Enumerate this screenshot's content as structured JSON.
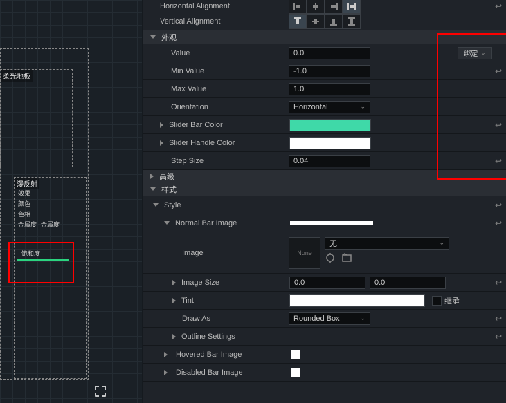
{
  "viewport": {
    "panel1_label": "柔光地板",
    "panel2_label": "漫反射",
    "sub1": "效果",
    "sub2": "颜色",
    "sub3": "色相",
    "sub4a": "金属度",
    "sub4b": "金属度",
    "sub5": "饱和度"
  },
  "props": {
    "horiz_align": "Horizontal Alignment",
    "vert_align": "Vertical Alignment",
    "section_appearance": "外观",
    "value_lbl": "Value",
    "value": "0.0",
    "minvalue_lbl": "Min Value",
    "minvalue": "-1.0",
    "maxvalue_lbl": "Max Value",
    "maxvalue": "1.0",
    "orientation_lbl": "Orientation",
    "orientation": "Horizontal",
    "barcolor_lbl": "Slider Bar Color",
    "handlecolor_lbl": "Slider Handle Color",
    "stepsize_lbl": "Step Size",
    "stepsize": "0.04",
    "section_adv": "高级",
    "section_style": "样式",
    "style_lbl": "Style",
    "normalbar_lbl": "Normal Bar Image",
    "image_lbl": "Image",
    "image_thumb": "None",
    "image_sel": "无",
    "imagesize_lbl": "Image Size",
    "imagesize_x": "0.0",
    "imagesize_y": "0.0",
    "tint_lbl": "Tint",
    "inherit": "继承",
    "drawas_lbl": "Draw As",
    "drawas": "Rounded Box",
    "outline_lbl": "Outline Settings",
    "hoveredbar_lbl": "Hovered Bar Image",
    "disabledbar_lbl": "Disabled Bar Image",
    "bind_btn": "绑定"
  }
}
